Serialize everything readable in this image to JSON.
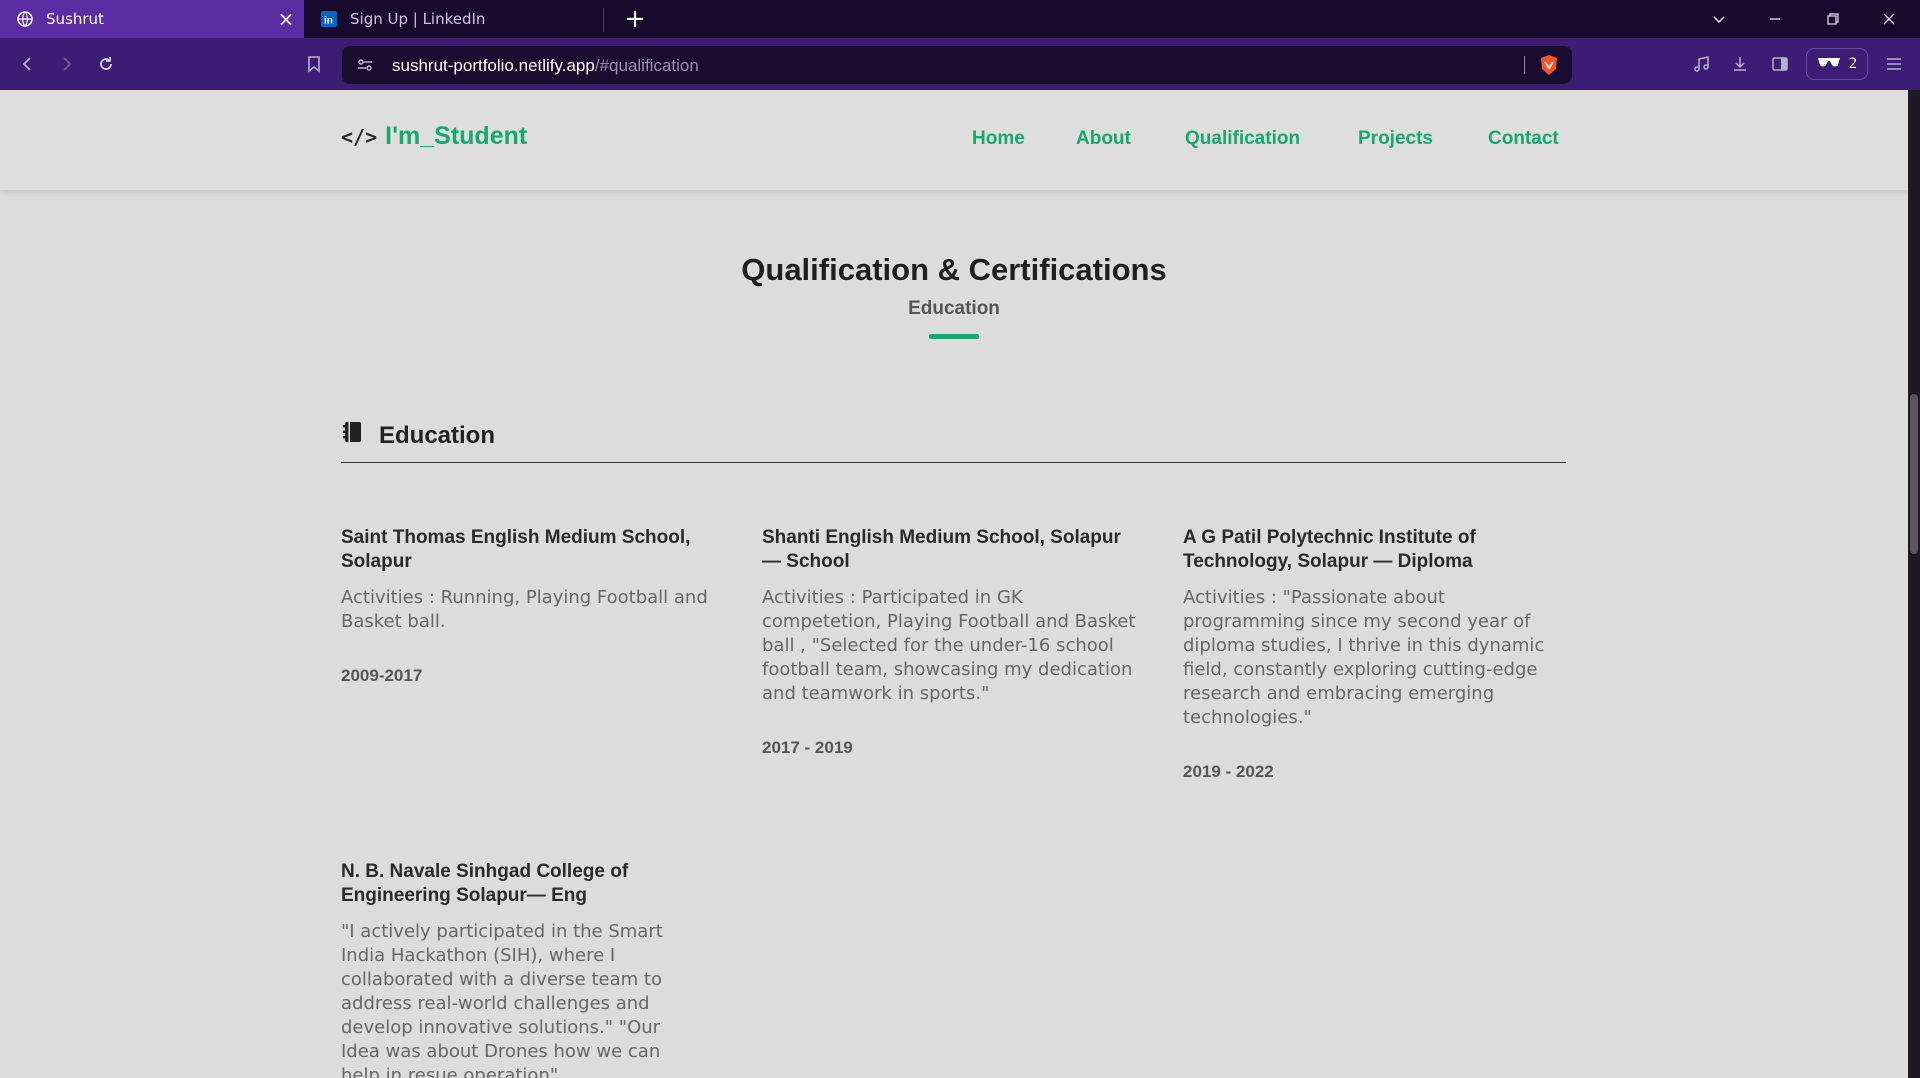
{
  "browser": {
    "tabs": [
      {
        "title": "Sushrut",
        "active": true
      },
      {
        "title": "Sign Up | LinkedIn",
        "active": false
      }
    ],
    "url_host": "sushrut-portfolio.netlify.app",
    "url_path": "/#qualification",
    "extension_count": "2"
  },
  "site": {
    "logo_text": "I'm_Student",
    "logo_symbol": "</>",
    "nav": [
      "Home",
      "About",
      "Qualification",
      "Projects",
      "Contact"
    ]
  },
  "section": {
    "title": "Qualification & Certifications",
    "subtitle": "Education",
    "heading": "Education"
  },
  "education": [
    {
      "institution": "Saint Thomas English Medium School, Solapur",
      "description": "Activities : Running, Playing Football and Basket ball.",
      "years": "2009-2017"
    },
    {
      "institution": "Shanti English Medium School, Solapur — School",
      "description": "Activities : Participated in GK competetion, Playing Football and Basket ball , \"Selected for the under-16 school football team, showcasing my dedication and teamwork in sports.\"",
      "years": "2017 - 2019"
    },
    {
      "institution": "A G Patil Polytechnic Institute of Technology, Solapur — Diploma",
      "description": "Activities : \"Passionate about programming since my second year of diploma studies, I thrive in this dynamic field, constantly exploring cutting-edge research and embracing emerging technologies.\"",
      "years": "2019 - 2022"
    },
    {
      "institution": "N. B. Navale Sinhgad College of Engineering Solapur— Eng",
      "description": "\"I actively participated in the Smart India Hackathon (SIH), where I collaborated with a diverse team to address real-world challenges and develop innovative solutions.\" \"Our Idea was about Drones how we can help in resue operation\"",
      "years": ""
    }
  ],
  "colors": {
    "accent": "#16a870",
    "tab_active": "#5b2da3",
    "toolbar": "#3b1d74",
    "tabbar": "#170a2c",
    "page_bg": "#dcdcdc"
  }
}
